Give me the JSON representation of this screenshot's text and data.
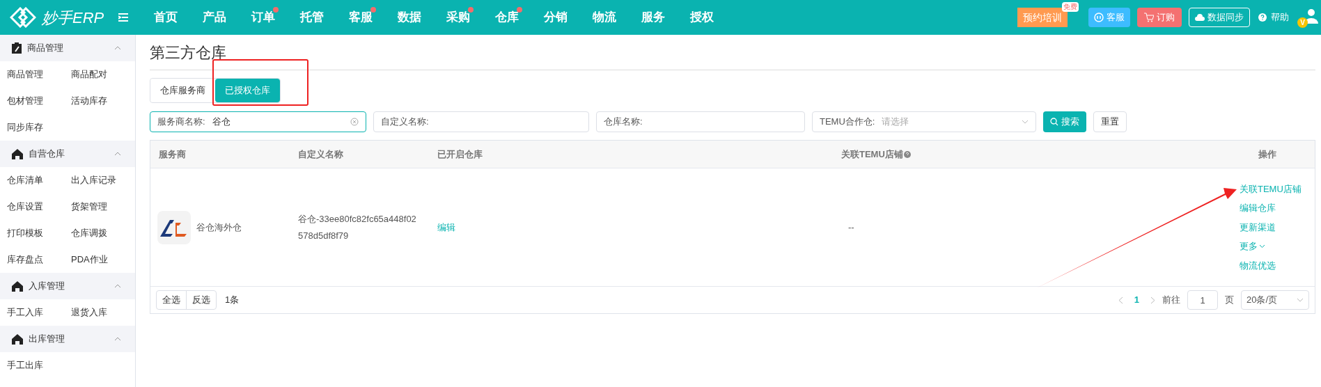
{
  "brand": {
    "name": "妙手ERP"
  },
  "nav": [
    {
      "label": "首页",
      "dot": false
    },
    {
      "label": "产品",
      "dot": false
    },
    {
      "label": "订单",
      "dot": true
    },
    {
      "label": "托管",
      "dot": false
    },
    {
      "label": "客服",
      "dot": true
    },
    {
      "label": "数据",
      "dot": false
    },
    {
      "label": "采购",
      "dot": true
    },
    {
      "label": "仓库",
      "dot": true
    },
    {
      "label": "分销",
      "dot": false
    },
    {
      "label": "物流",
      "dot": false
    },
    {
      "label": "服务",
      "dot": false
    },
    {
      "label": "授权",
      "dot": false
    }
  ],
  "header_actions": {
    "training": "预约培训",
    "training_badge": "免费",
    "service": "客服",
    "order": "订购",
    "sync": "数据同步",
    "help": "帮助",
    "avatar_badge": "V"
  },
  "sidebar": [
    {
      "title": "商品管理",
      "expanded": true,
      "items": [
        "商品管理",
        "商品配对",
        "包材管理",
        "活动库存",
        "同步库存"
      ]
    },
    {
      "title": "自营仓库",
      "expanded": true,
      "items": [
        "仓库清单",
        "出入库记录",
        "仓库设置",
        "货架管理",
        "打印模板",
        "仓库调拨",
        "库存盘点",
        "PDA作业"
      ]
    },
    {
      "title": "入库管理",
      "expanded": true,
      "items": [
        "手工入库",
        "退货入库"
      ]
    },
    {
      "title": "出库管理",
      "expanded": true,
      "items": [
        "手工出库"
      ]
    }
  ],
  "page": {
    "title": "第三方仓库"
  },
  "tabs": [
    {
      "label": "仓库服务商",
      "selected": false
    },
    {
      "label": "已授权仓库",
      "selected": true
    }
  ],
  "filters": [
    {
      "kind": "text",
      "label": "服务商名称:",
      "value": "谷仓",
      "focused": true
    },
    {
      "kind": "text",
      "label": "自定义名称:",
      "focused": false
    },
    {
      "kind": "text",
      "label": "仓库名称:",
      "focused": false
    },
    {
      "kind": "select",
      "label": "TEMU合作仓:",
      "placeholder": "请选择",
      "focused": false
    }
  ],
  "search_button": "搜索",
  "reset_button": "重置",
  "table": {
    "columns": [
      {
        "label": "服务商",
        "help": false
      },
      {
        "label": "自定义名称",
        "help": false
      },
      {
        "label": "已开启仓库",
        "help": false
      },
      {
        "label": "关联TEMU店铺",
        "help": true
      },
      {
        "label": "操作",
        "help": false
      }
    ],
    "rows": [
      {
        "provider": "谷仓海外仓",
        "custom_name": "谷仓-33ee80fc82fc65a448f02578d5df8f79",
        "enabled_link": "编辑",
        "temu_store": "--",
        "actions": [
          {
            "label": "关联TEMU店铺",
            "menu": false
          },
          {
            "label": "编辑仓库",
            "menu": false
          },
          {
            "label": "更新渠道",
            "menu": false
          },
          {
            "label": "更多",
            "menu": true
          },
          {
            "label": "物流优选",
            "menu": false
          }
        ]
      }
    ]
  },
  "footer": {
    "select_all": "全选",
    "invert": "反选",
    "count": "1条"
  },
  "pagination": {
    "pages": [
      {
        "label": "1",
        "selected": true
      }
    ],
    "goto": "前往",
    "page_input": "1",
    "page_unit": "页",
    "page_size": "20条/页"
  },
  "annotations": {
    "highlight_frame": true,
    "pointer_arrow": true
  }
}
